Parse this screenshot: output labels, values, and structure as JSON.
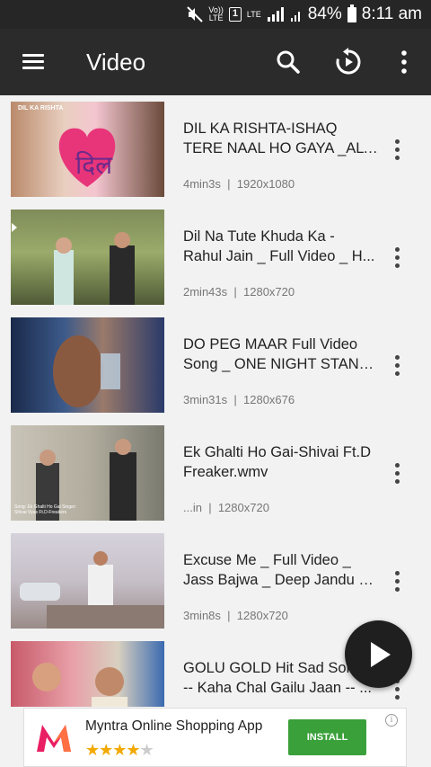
{
  "status_bar": {
    "volte": "Vo))",
    "lte": "LTE",
    "sim": "1",
    "lte2": "LTE",
    "battery_pct": "84%",
    "time": "8:11 am"
  },
  "toolbar": {
    "title": "Video",
    "icons": [
      "menu-icon",
      "search-icon",
      "replay-icon",
      "more-vert-icon"
    ]
  },
  "videos": [
    {
      "title_line1": "DIL KA RISHTA-ISHAQ",
      "title_line2": "TERE NAAL HO GAYA _ALT...",
      "duration": "4min3s",
      "resolution": "1920x1080",
      "thumb_overlay": "DIL KA RISHTA"
    },
    {
      "title_line1": "Dil Na Tute Khuda Ka -",
      "title_line2": "Rahul Jain _ Full Video _ H...",
      "duration": "2min43s",
      "resolution": "1280x720",
      "thumb_overlay": ""
    },
    {
      "title_line1": "DO PEG MAAR Full Video",
      "title_line2": "Song _ ONE NIGHT STAND...",
      "duration": "3min31s",
      "resolution": "1280x676",
      "thumb_overlay": ""
    },
    {
      "title_line1": "Ek Ghalti Ho Gai-Shivai Ft.D",
      "title_line2": "Freaker.wmv",
      "duration": "...in",
      "resolution": "1280x720",
      "thumb_overlay": "Song: Ek Ghalti Ho Gai Singer: Shivai Vyas Ft.D-Freakers"
    },
    {
      "title_line1": "Excuse Me _ Full Video _",
      "title_line2": "Jass Bajwa _ Deep Jandu _ ...",
      "duration": "3min8s",
      "resolution": "1280x720",
      "thumb_overlay": ""
    },
    {
      "title_line1": "GOLU GOLD Hit Sad Son",
      "title_line2": "-- Kaha Chal Gailu Jaan -- ...",
      "duration": "",
      "resolution": "",
      "thumb_overlay": ""
    }
  ],
  "meta_separator": "|",
  "ad": {
    "app_name": "Myntra Online Shopping App",
    "install_label": "INSTALL",
    "info": "i",
    "rating_stars": 4,
    "rating_max": 5
  },
  "colors": {
    "toolbar_bg": "#2b2b2b",
    "statusbar_bg": "#262626",
    "page_bg": "#f2f2f2",
    "install_green": "#3aa03a",
    "fab_bg": "#1f1f1f"
  }
}
